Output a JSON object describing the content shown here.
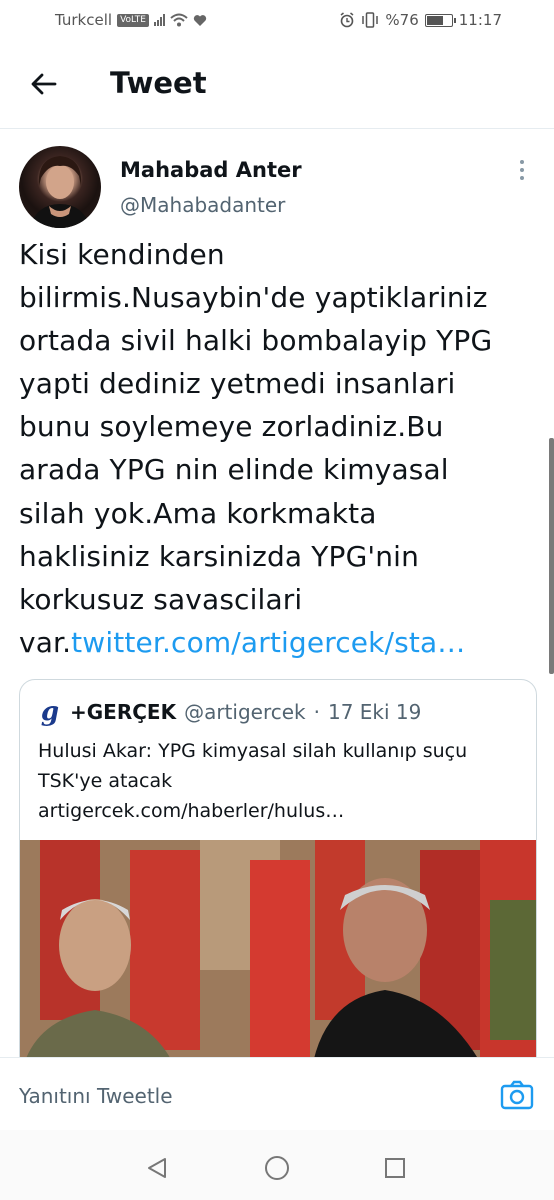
{
  "status_bar": {
    "carrier": "Turkcell",
    "volte": "VoLTE",
    "battery_text": "%76",
    "battery_level": 0.76,
    "time": "11:17"
  },
  "header": {
    "title": "Tweet"
  },
  "tweet": {
    "author_name": "Mahabad Anter",
    "author_handle": "@Mahabadanter",
    "text_lines": [
      "Kisi kendinden",
      "bilirmis.Nusaybin'de yaptiklariniz",
      "ortada sivil halki bombalayip YPG",
      "yapti dediniz yetmedi insanlari",
      "bunu soylemeye zorladiniz.Bu",
      "arada YPG nin elinde kimyasal",
      "silah yok.Ama korkmakta",
      "haklisiniz karsinizda YPG'nin",
      "korkusuz savascilari"
    ],
    "last_line_prefix": "var.",
    "link_text": "twitter.com/artigercek/sta…"
  },
  "quote": {
    "logo": "g",
    "name": "+GERÇEK",
    "handle": "@artigercek",
    "separator": "·",
    "date": "17 Eki 19",
    "line1": "Hulusi Akar: YPG kimyasal silah kullanıp suçu",
    "line2": "TSK'ye atacak",
    "link": "artigercek.com/haberler/hulus…"
  },
  "reply": {
    "placeholder": "Yanıtını Tweetle"
  },
  "icons": {
    "back": "arrow-left-icon",
    "more": "more-vertical-icon",
    "camera": "camera-icon",
    "nav_back": "triangle-back-icon",
    "nav_home": "circle-home-icon",
    "nav_recent": "square-recent-icon"
  },
  "colors": {
    "link": "#1d9bf0",
    "text": "#0f1419",
    "secondary": "#536471"
  }
}
